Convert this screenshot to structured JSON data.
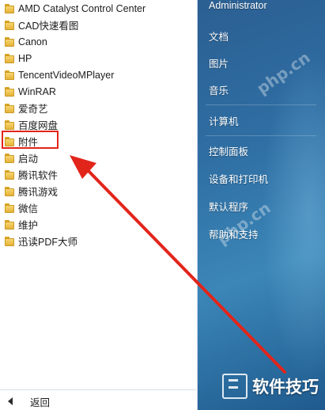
{
  "left_pane": {
    "programs": [
      {
        "label": "AMD Catalyst Control Center"
      },
      {
        "label": "CAD快速看图"
      },
      {
        "label": "Canon"
      },
      {
        "label": "HP"
      },
      {
        "label": "TencentVideoMPlayer"
      },
      {
        "label": "WinRAR"
      },
      {
        "label": "爱奇艺"
      },
      {
        "label": "百度网盘"
      },
      {
        "label": "附件"
      },
      {
        "label": "启动"
      },
      {
        "label": "腾讯软件"
      },
      {
        "label": "腾讯游戏"
      },
      {
        "label": "微信"
      },
      {
        "label": "维护"
      },
      {
        "label": "迅读PDF大师"
      }
    ],
    "back_label": "返回"
  },
  "right_pane": {
    "user_name": "Administrator",
    "items": [
      {
        "label": "文档"
      },
      {
        "label": "图片"
      },
      {
        "label": "音乐"
      },
      {
        "label": "计算机"
      },
      {
        "label": "控制面板"
      },
      {
        "label": "设备和打印机"
      },
      {
        "label": "默认程序"
      },
      {
        "label": "帮助和支持"
      }
    ]
  },
  "annotation": {
    "highlight_color": "#e2251b",
    "arrow_color": "#e2251b"
  },
  "watermark": {
    "text": "php.cn",
    "brand": "软件技巧"
  }
}
